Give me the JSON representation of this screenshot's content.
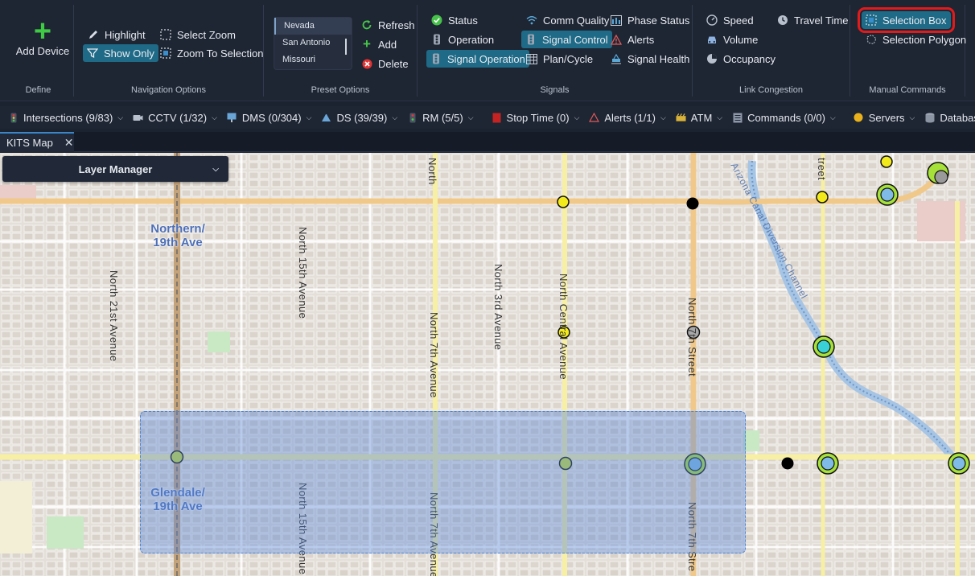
{
  "ribbon": {
    "define": {
      "label": "Define",
      "add_device": "Add Device"
    },
    "navigation": {
      "label": "Navigation Options",
      "highlight": "Highlight",
      "show_only": "Show Only",
      "select_zoom": "Select Zoom",
      "zoom_to_selection": "Zoom To Selection"
    },
    "preset": {
      "label": "Preset Options",
      "items": [
        "Nevada",
        "San Antonio",
        "Missouri"
      ],
      "refresh": "Refresh",
      "add": "Add",
      "delete": "Delete"
    },
    "signals": {
      "label": "Signals",
      "status": "Status",
      "operation": "Operation",
      "signal_operation": "Signal Operation",
      "comm_quality": "Comm Quality",
      "signal_control": "Signal Control",
      "plan_cycle": "Plan/Cycle",
      "phase_status": "Phase Status",
      "alerts": "Alerts",
      "signal_health": "Signal Health"
    },
    "link_congestion": {
      "label": "Link Congestion",
      "speed": "Speed",
      "volume": "Volume",
      "occupancy": "Occupancy",
      "travel_time": "Travel Time"
    },
    "manual": {
      "label": "Manual Commands",
      "selection_box": "Selection Box",
      "selection_polygon": "Selection Polygon"
    }
  },
  "filters": [
    {
      "label": "Intersections (9/83)",
      "icon": "traffic-light-icon"
    },
    {
      "label": "CCTV (1/32)",
      "icon": "camera-icon"
    },
    {
      "label": "DMS (0/304)",
      "icon": "sign-icon"
    },
    {
      "label": "DS (39/39)",
      "icon": "detector-icon"
    },
    {
      "label": "RM (5/5)",
      "icon": "ramp-meter-icon"
    },
    {
      "label": "Stop Time (0)",
      "icon": "stop-icon"
    },
    {
      "label": "Alerts (1/1)",
      "icon": "alert-icon"
    },
    {
      "label": "ATM",
      "icon": "atm-icon"
    },
    {
      "label": "Commands (0/0)",
      "icon": "commands-icon"
    },
    {
      "label": "Servers",
      "icon": "server-icon"
    },
    {
      "label": "Database",
      "icon": "database-icon"
    }
  ],
  "tab": {
    "label": "KITS Map"
  },
  "map": {
    "layer_manager": "Layer Manager",
    "areas": {
      "northern": "Northern/\n19th Ave",
      "glendale": "Glendale/\n19th Ave"
    },
    "roads": {
      "n21": "North 21st Avenue",
      "n15": "North 15th Avenue",
      "n15b": "North 15th Avenue",
      "n7": "North 7th Avenue",
      "n7b": "North 7th Avenue",
      "n3": "North 3rd Avenue",
      "central": "North Central Avenue",
      "n7st": "North 7th Street",
      "n7stb": "North 7th Stre",
      "canal": "Arizona Canal Diversion Channel",
      "street_top": "treet",
      "top_n": "North"
    }
  },
  "colors": {
    "accent": "#1f6a86",
    "highlight_outline": "#e11b1b",
    "signal_yellow": "#f2ea1a",
    "signal_green": "#a6e13a",
    "signal_blue": "#7fbbe6",
    "selection_fill": "#5a87d7"
  }
}
